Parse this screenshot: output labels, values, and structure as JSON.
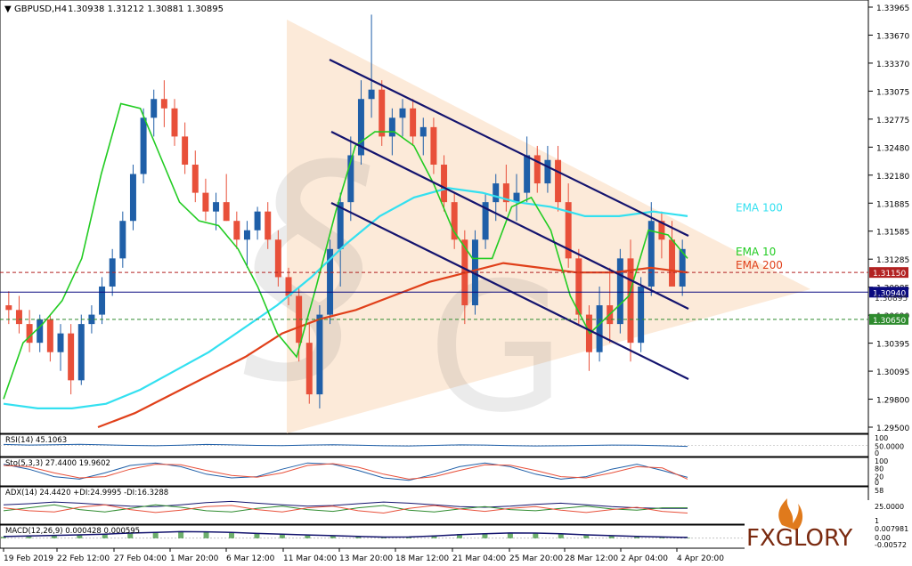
{
  "header": {
    "symbol": "GBPUSD,H4",
    "ohlc": "1.30938 1.31212 1.30881 1.30895"
  },
  "colors": {
    "bull": "#1f5fa8",
    "bear": "#e8503a",
    "ema10": "#22cc22",
    "ema100": "#33e0f0",
    "ema200": "#e0401a",
    "channel": "#14146e",
    "triangle": "#fbe6d2",
    "level_red": "#b22222",
    "level_navy": "#0a0a80",
    "level_green": "#2e8b2e"
  },
  "chart_data": [
    {
      "type": "candlestick",
      "title": "GBPUSD,H4",
      "ylim": [
        1.295,
        1.3398
      ],
      "y_ticks": [
        "1.33965",
        "1.33670",
        "1.33370",
        "1.33075",
        "1.32775",
        "1.32480",
        "1.32180",
        "1.31885",
        "1.31585",
        "1.31285",
        "1.30985",
        "1.30690",
        "1.30395",
        "1.30095",
        "1.29800",
        "1.29500"
      ],
      "x_ticks": [
        "19 Feb 2019",
        "22 Feb 12:00",
        "27 Feb 04:00",
        "1 Mar 20:00",
        "6 Mar 12:00",
        "11 Mar 04:00",
        "13 Mar 20:00",
        "18 Mar 12:00",
        "21 Mar 04:00",
        "25 Mar 20:00",
        "28 Mar 12:00",
        "2 Apr 04:00",
        "4 Apr 20:00"
      ],
      "price_tags": [
        {
          "label": "1.31150",
          "value": 1.3115,
          "color": "#b22222"
        },
        {
          "label": "1.30940",
          "value": 1.3094,
          "color": "#0a0a80"
        },
        {
          "label": "1.30650",
          "value": 1.3065,
          "color": "#2e8b2e"
        }
      ],
      "hidden_tag": "1.30895",
      "indicators": [
        {
          "name": "EMA 100",
          "color": "#33e0f0"
        },
        {
          "name": "EMA 10",
          "color": "#22cc22"
        },
        {
          "name": "EMA 200",
          "color": "#e0401a"
        }
      ],
      "ema10_path": [
        1.298,
        1.304,
        1.306,
        1.3085,
        1.313,
        1.322,
        1.3295,
        1.329,
        1.324,
        1.319,
        1.317,
        1.3165,
        1.314,
        1.31,
        1.305,
        1.3025,
        1.31,
        1.318,
        1.325,
        1.3265,
        1.3265,
        1.325,
        1.321,
        1.316,
        1.313,
        1.313,
        1.3185,
        1.3195,
        1.316,
        1.309,
        1.305,
        1.307,
        1.309,
        1.316,
        1.3155,
        1.313
      ],
      "ema100_path": [
        1.2975,
        1.297,
        1.297,
        1.2975,
        1.299,
        1.301,
        1.303,
        1.3055,
        1.308,
        1.311,
        1.3145,
        1.3175,
        1.3195,
        1.3205,
        1.32,
        1.319,
        1.3185,
        1.3175,
        1.3175,
        1.318,
        1.3175
      ],
      "ema200_path": [
        1.295,
        1.2965,
        1.2985,
        1.3005,
        1.3025,
        1.305,
        1.3065,
        1.3075,
        1.309,
        1.3105,
        1.3115,
        1.3125,
        1.312,
        1.3115,
        1.3115,
        1.312,
        1.3115
      ],
      "candles": [
        [
          1.308,
          1.3095,
          1.306,
          1.3075
        ],
        [
          1.3075,
          1.309,
          1.305,
          1.306
        ],
        [
          1.306,
          1.3075,
          1.303,
          1.304
        ],
        [
          1.304,
          1.307,
          1.303,
          1.3065
        ],
        [
          1.3065,
          1.307,
          1.302,
          1.303
        ],
        [
          1.303,
          1.306,
          1.301,
          1.305
        ],
        [
          1.305,
          1.306,
          1.2985,
          1.3
        ],
        [
          1.3,
          1.307,
          1.2995,
          1.306
        ],
        [
          1.306,
          1.308,
          1.305,
          1.307
        ],
        [
          1.307,
          1.311,
          1.306,
          1.31
        ],
        [
          1.31,
          1.314,
          1.309,
          1.313
        ],
        [
          1.313,
          1.318,
          1.312,
          1.317
        ],
        [
          1.317,
          1.323,
          1.316,
          1.322
        ],
        [
          1.322,
          1.329,
          1.321,
          1.328
        ],
        [
          1.328,
          1.331,
          1.326,
          1.33
        ],
        [
          1.33,
          1.332,
          1.327,
          1.329
        ],
        [
          1.329,
          1.33,
          1.325,
          1.326
        ],
        [
          1.326,
          1.3275,
          1.322,
          1.323
        ],
        [
          1.323,
          1.3245,
          1.319,
          1.32
        ],
        [
          1.32,
          1.3215,
          1.317,
          1.318
        ],
        [
          1.318,
          1.32,
          1.316,
          1.319
        ],
        [
          1.319,
          1.322,
          1.317,
          1.317
        ],
        [
          1.317,
          1.318,
          1.314,
          1.315
        ],
        [
          1.315,
          1.317,
          1.312,
          1.316
        ],
        [
          1.316,
          1.3185,
          1.315,
          1.318
        ],
        [
          1.318,
          1.319,
          1.314,
          1.315
        ],
        [
          1.315,
          1.316,
          1.31,
          1.311
        ],
        [
          1.311,
          1.312,
          1.308,
          1.309
        ],
        [
          1.309,
          1.31,
          1.302,
          1.304
        ],
        [
          1.304,
          1.306,
          1.2975,
          1.2985
        ],
        [
          1.2985,
          1.308,
          1.297,
          1.307
        ],
        [
          1.307,
          1.315,
          1.306,
          1.314
        ],
        [
          1.314,
          1.32,
          1.31,
          1.319
        ],
        [
          1.319,
          1.326,
          1.317,
          1.324
        ],
        [
          1.324,
          1.332,
          1.323,
          1.33
        ],
        [
          1.33,
          1.339,
          1.328,
          1.331
        ],
        [
          1.331,
          1.332,
          1.325,
          1.326
        ],
        [
          1.326,
          1.329,
          1.324,
          1.328
        ],
        [
          1.328,
          1.33,
          1.326,
          1.329
        ],
        [
          1.329,
          1.33,
          1.325,
          1.326
        ],
        [
          1.326,
          1.328,
          1.324,
          1.327
        ],
        [
          1.327,
          1.328,
          1.322,
          1.323
        ],
        [
          1.323,
          1.324,
          1.318,
          1.319
        ],
        [
          1.319,
          1.32,
          1.314,
          1.315
        ],
        [
          1.315,
          1.316,
          1.306,
          1.308
        ],
        [
          1.308,
          1.316,
          1.307,
          1.315
        ],
        [
          1.315,
          1.32,
          1.314,
          1.319
        ],
        [
          1.319,
          1.322,
          1.317,
          1.321
        ],
        [
          1.321,
          1.323,
          1.318,
          1.319
        ],
        [
          1.319,
          1.322,
          1.317,
          1.32
        ],
        [
          1.32,
          1.326,
          1.319,
          1.324
        ],
        [
          1.324,
          1.325,
          1.32,
          1.321
        ],
        [
          1.321,
          1.325,
          1.32,
          1.3235
        ],
        [
          1.3235,
          1.325,
          1.318,
          1.319
        ],
        [
          1.319,
          1.321,
          1.312,
          1.313
        ],
        [
          1.313,
          1.314,
          1.306,
          1.307
        ],
        [
          1.307,
          1.308,
          1.301,
          1.303
        ],
        [
          1.303,
          1.31,
          1.302,
          1.308
        ],
        [
          1.308,
          1.312,
          1.304,
          1.306
        ],
        [
          1.306,
          1.314,
          1.305,
          1.313
        ],
        [
          1.313,
          1.315,
          1.302,
          1.304
        ],
        [
          1.304,
          1.311,
          1.303,
          1.31
        ],
        [
          1.31,
          1.319,
          1.309,
          1.317
        ],
        [
          1.317,
          1.318,
          1.313,
          1.315
        ],
        [
          1.315,
          1.317,
          1.312,
          1.31
        ],
        [
          1.31,
          1.315,
          1.309,
          1.314
        ]
      ]
    },
    {
      "type": "line",
      "name": "RSI(14)",
      "label": "RSI(14) 45.1063",
      "ylim": [
        0,
        100
      ],
      "tick_labels": [
        "100",
        "50.0000",
        "0"
      ],
      "values": [
        55,
        52,
        54,
        56,
        53,
        50,
        48,
        51,
        55,
        53,
        50,
        49,
        52,
        54,
        51,
        48,
        47,
        50,
        53,
        52,
        49,
        47,
        48,
        50,
        52,
        51,
        48,
        45
      ]
    },
    {
      "type": "line",
      "name": "Sto(5,3,3)",
      "label": "Sto(5,3,3) 27.4400 19.9602",
      "ylim": [
        0,
        100
      ],
      "tick_labels": [
        "100",
        "80",
        "20",
        "0"
      ],
      "series": [
        {
          "name": "main",
          "color": "#1f5fa8",
          "values": [
            80,
            60,
            30,
            20,
            45,
            75,
            85,
            70,
            40,
            25,
            30,
            60,
            85,
            80,
            55,
            25,
            15,
            40,
            70,
            85,
            70,
            40,
            20,
            30,
            60,
            80,
            55,
            27
          ]
        },
        {
          "name": "signal",
          "color": "#e8503a",
          "values": [
            75,
            70,
            45,
            25,
            30,
            60,
            80,
            78,
            55,
            35,
            28,
            45,
            75,
            82,
            68,
            40,
            20,
            30,
            55,
            78,
            76,
            55,
            30,
            25,
            45,
            70,
            65,
            20
          ]
        }
      ]
    },
    {
      "type": "line",
      "name": "ADX(14)",
      "label": "ADX(14) 24.4420 +DI:24.9995 -DI:16.3288",
      "ylim": [
        0,
        58
      ],
      "tick_labels": [
        "58",
        "25.0000",
        "1"
      ],
      "series": [
        {
          "name": "ADX",
          "color": "#14146e",
          "values": [
            30,
            32,
            35,
            33,
            30,
            28,
            27,
            30,
            34,
            36,
            33,
            30,
            28,
            29,
            32,
            35,
            33,
            30,
            27,
            26,
            28,
            31,
            33,
            30,
            27,
            25,
            24,
            24
          ]
        },
        {
          "name": "+DI",
          "color": "#2e8b2e",
          "values": [
            20,
            25,
            30,
            22,
            18,
            24,
            30,
            26,
            20,
            18,
            24,
            28,
            22,
            19,
            25,
            29,
            21,
            18,
            23,
            27,
            22,
            20,
            24,
            28,
            23,
            21,
            25,
            25
          ]
        },
        {
          "name": "-DI",
          "color": "#e8503a",
          "values": [
            25,
            20,
            18,
            26,
            30,
            22,
            17,
            21,
            27,
            29,
            22,
            18,
            25,
            28,
            20,
            16,
            24,
            29,
            23,
            19,
            24,
            27,
            21,
            17,
            22,
            26,
            19,
            16
          ]
        }
      ]
    },
    {
      "type": "bar",
      "name": "MACD(12,26,9)",
      "label": "MACD(12,26,9) 0.000428 0.000595",
      "ylim": [
        -0.00572,
        0.007981
      ],
      "tick_labels": [
        "0.007981",
        "0.00",
        "-0.00572"
      ],
      "values": [
        0.001,
        0.0015,
        0.002,
        0.0025,
        0.003,
        0.004,
        0.0045,
        0.005,
        0.0045,
        0.004,
        0.003,
        0.0025,
        0.002,
        0.0015,
        0.001,
        0.0005,
        0.001,
        0.002,
        0.003,
        0.0035,
        0.004,
        0.0035,
        0.003,
        0.002,
        0.0015,
        0.001,
        0.0008,
        0.0004
      ],
      "signal": [
        0.0012,
        0.0016,
        0.002,
        0.0024,
        0.0029,
        0.0036,
        0.0041,
        0.0046,
        0.0045,
        0.0041,
        0.0034,
        0.0028,
        0.0023,
        0.0018,
        0.0013,
        0.0008,
        0.0009,
        0.0016,
        0.0025,
        0.0031,
        0.0037,
        0.0036,
        0.0031,
        0.0024,
        0.0018,
        0.0013,
        0.0009,
        0.0006
      ]
    }
  ],
  "logo": {
    "text": "FXGLORY"
  }
}
